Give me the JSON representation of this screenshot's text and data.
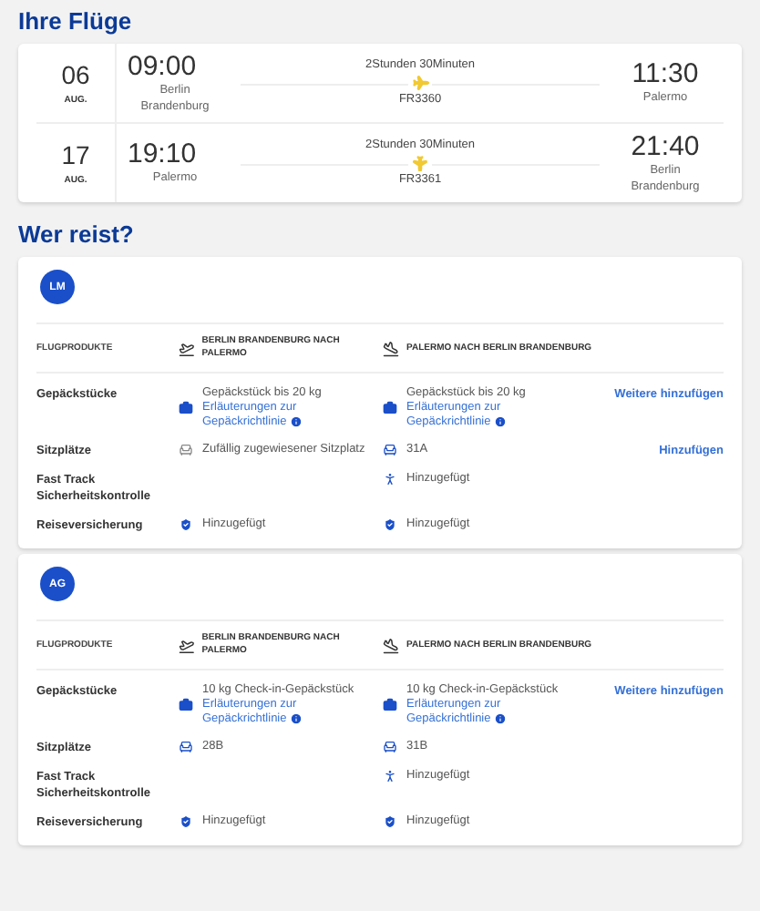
{
  "flights_title": "Ihre Flüge",
  "flights": [
    {
      "kind": "outbound",
      "day": "06",
      "month": "AUG.",
      "dep_time": "09:00",
      "dep_city": "Berlin Brandenburg",
      "duration": "2Stunden 30Minuten",
      "flight_no": "FR3360",
      "arr_time": "11:30",
      "arr_city": "Palermo"
    },
    {
      "kind": "return",
      "day": "17",
      "month": "AUG.",
      "dep_time": "19:10",
      "dep_city": "Palermo",
      "duration": "2Stunden 30Minuten",
      "flight_no": "FR3361",
      "arr_time": "21:40",
      "arr_city": "Berlin Brandenburg"
    }
  ],
  "travellers_title": "Wer reist?",
  "passengers": [
    {
      "initials": "LM",
      "header": {
        "label": "FLUGPRODUKTE",
        "legs": [
          {
            "kind": "outbound",
            "text": "BERLIN BRANDENBURG NACH PALERMO"
          },
          {
            "kind": "return",
            "text": "PALERMO NACH BERLIN BRANDENBURG"
          }
        ]
      },
      "rows": [
        {
          "kind": "baggage",
          "label": "Gepäckstücke",
          "cells": [
            {
              "text": "Gepäckstück bis 20 kg",
              "link": "Erläuterungen zur Gepäckrichtlinie"
            },
            {
              "text": "Gepäckstück bis 20 kg",
              "link": "Erläuterungen zur Gepäckrichtlinie"
            }
          ],
          "action": "Weitere hinzufügen"
        },
        {
          "kind": "seat",
          "label": "Sitzplätze",
          "cells": [
            {
              "text": "Zufällig zugewiesener Sitzplatz",
              "random": true
            },
            {
              "text": "31A",
              "random": false
            }
          ],
          "action": "Hinzufügen"
        },
        {
          "kind": "fasttrack",
          "label": "Fast Track Sicherheitskontrolle",
          "cells": [
            null,
            {
              "text": "Hinzugefügt"
            }
          ]
        },
        {
          "kind": "insurance",
          "label": "Reiseversicherung",
          "cells": [
            {
              "text": "Hinzugefügt"
            },
            {
              "text": "Hinzugefügt"
            }
          ]
        }
      ]
    },
    {
      "initials": "AG",
      "header": {
        "label": "FLUGPRODUKTE",
        "legs": [
          {
            "kind": "outbound",
            "text": "BERLIN BRANDENBURG NACH PALERMO"
          },
          {
            "kind": "return",
            "text": "PALERMO NACH BERLIN BRANDENBURG"
          }
        ]
      },
      "rows": [
        {
          "kind": "baggage",
          "label": "Gepäckstücke",
          "cells": [
            {
              "text": "10 kg Check-in-Gepäckstück",
              "link": "Erläuterungen zur Gepäckrichtlinie"
            },
            {
              "text": "10 kg Check-in-Gepäckstück",
              "link": "Erläuterungen zur Gepäckrichtlinie"
            }
          ],
          "action": "Weitere hinzufügen"
        },
        {
          "kind": "seat",
          "label": "Sitzplätze",
          "cells": [
            {
              "text": "28B",
              "random": false
            },
            {
              "text": "31B",
              "random": false
            }
          ]
        },
        {
          "kind": "fasttrack",
          "label": "Fast Track Sicherheitskontrolle",
          "cells": [
            null,
            {
              "text": "Hinzugefügt"
            }
          ]
        },
        {
          "kind": "insurance",
          "label": "Reiseversicherung",
          "cells": [
            {
              "text": "Hinzugefügt"
            },
            {
              "text": "Hinzugefügt"
            }
          ]
        }
      ]
    }
  ]
}
